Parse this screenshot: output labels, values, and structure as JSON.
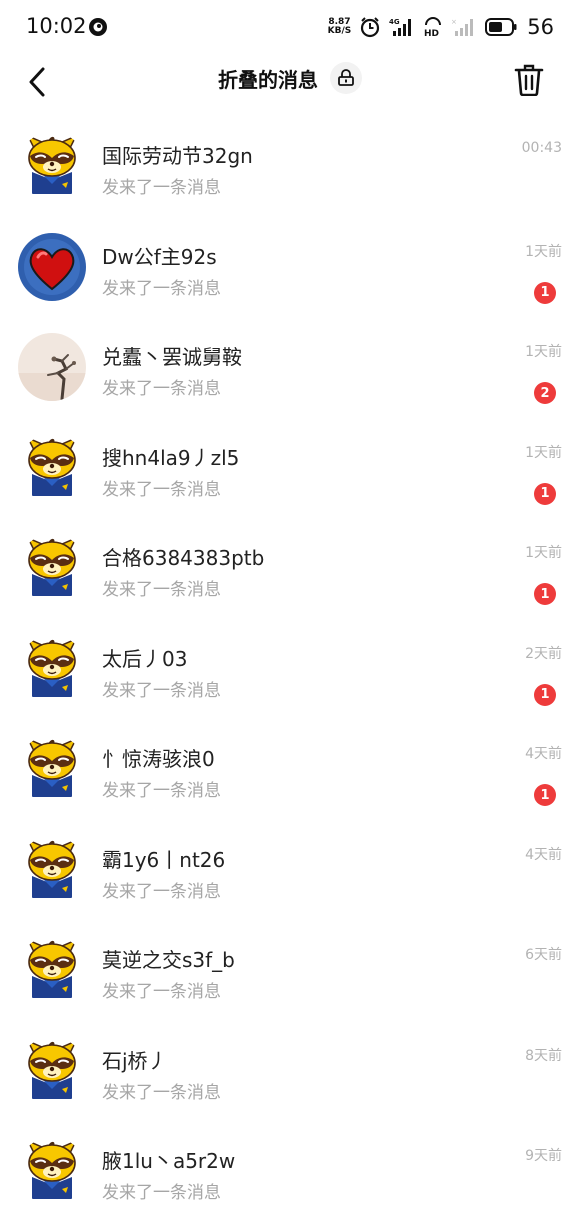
{
  "status_bar": {
    "time": "10:02",
    "net_speed_value": "8.87",
    "net_speed_unit": "KB/S",
    "battery": "56"
  },
  "header": {
    "title": "折叠的消息"
  },
  "messages": [
    {
      "name": "国际劳动节32gn",
      "preview": "发来了一条消息",
      "time": "00:43",
      "unread": "",
      "avatar": "raccoon"
    },
    {
      "name": "Dw公f主92s",
      "preview": "发来了一条消息",
      "time": "1天前",
      "unread": "1",
      "avatar": "heart"
    },
    {
      "name": "兑蠹丶罢诚舅鞍",
      "preview": "发来了一条消息",
      "time": "1天前",
      "unread": "2",
      "avatar": "branch"
    },
    {
      "name": "搜hn4la9丿zl5",
      "preview": "发来了一条消息",
      "time": "1天前",
      "unread": "1",
      "avatar": "raccoon"
    },
    {
      "name": "合格6384383ptb",
      "preview": "发来了一条消息",
      "time": "1天前",
      "unread": "1",
      "avatar": "raccoon"
    },
    {
      "name": "太后丿03",
      "preview": "发来了一条消息",
      "time": "2天前",
      "unread": "1",
      "avatar": "raccoon"
    },
    {
      "name": "忄惊涛骇浪0",
      "preview": "发来了一条消息",
      "time": "4天前",
      "unread": "1",
      "avatar": "raccoon"
    },
    {
      "name": "霸1y6丨nt26",
      "preview": "发来了一条消息",
      "time": "4天前",
      "unread": "",
      "avatar": "raccoon"
    },
    {
      "name": "莫逆之交s3f_b",
      "preview": "发来了一条消息",
      "time": "6天前",
      "unread": "",
      "avatar": "raccoon"
    },
    {
      "name": "石j桥丿",
      "preview": "发来了一条消息",
      "time": "8天前",
      "unread": "",
      "avatar": "raccoon"
    },
    {
      "name": "腋1lu丶a5r2w",
      "preview": "发来了一条消息",
      "time": "9天前",
      "unread": "",
      "avatar": "raccoon"
    }
  ]
}
